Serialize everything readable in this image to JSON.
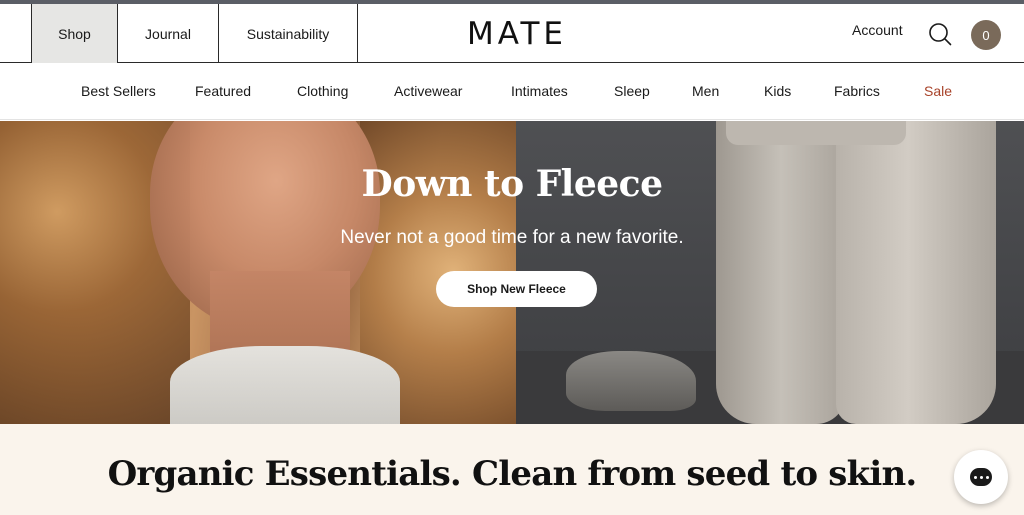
{
  "header": {
    "tabs": [
      {
        "label": "Shop",
        "active": true
      },
      {
        "label": "Journal",
        "active": false
      },
      {
        "label": "Sustainability",
        "active": false
      }
    ],
    "logo": "MATE",
    "account_label": "Account",
    "search_icon": "search-icon",
    "cart_count": "0",
    "cart_color": "#7a6a5a"
  },
  "nav": {
    "items": [
      {
        "label": "Best Sellers"
      },
      {
        "label": "Featured"
      },
      {
        "label": "Clothing"
      },
      {
        "label": "Activewear"
      },
      {
        "label": "Intimates"
      },
      {
        "label": "Sleep"
      },
      {
        "label": "Men"
      },
      {
        "label": "Kids"
      },
      {
        "label": "Fabrics"
      },
      {
        "label": "Sale",
        "color": "#a8432a"
      }
    ]
  },
  "hero": {
    "title": "Down to Fleece",
    "subtitle": "Never not a good time for a new favorite.",
    "cta_label": "Shop New Fleece"
  },
  "tagline": "Organic Essentials. Clean from seed to skin.",
  "chat": {
    "icon": "chat-icon"
  }
}
